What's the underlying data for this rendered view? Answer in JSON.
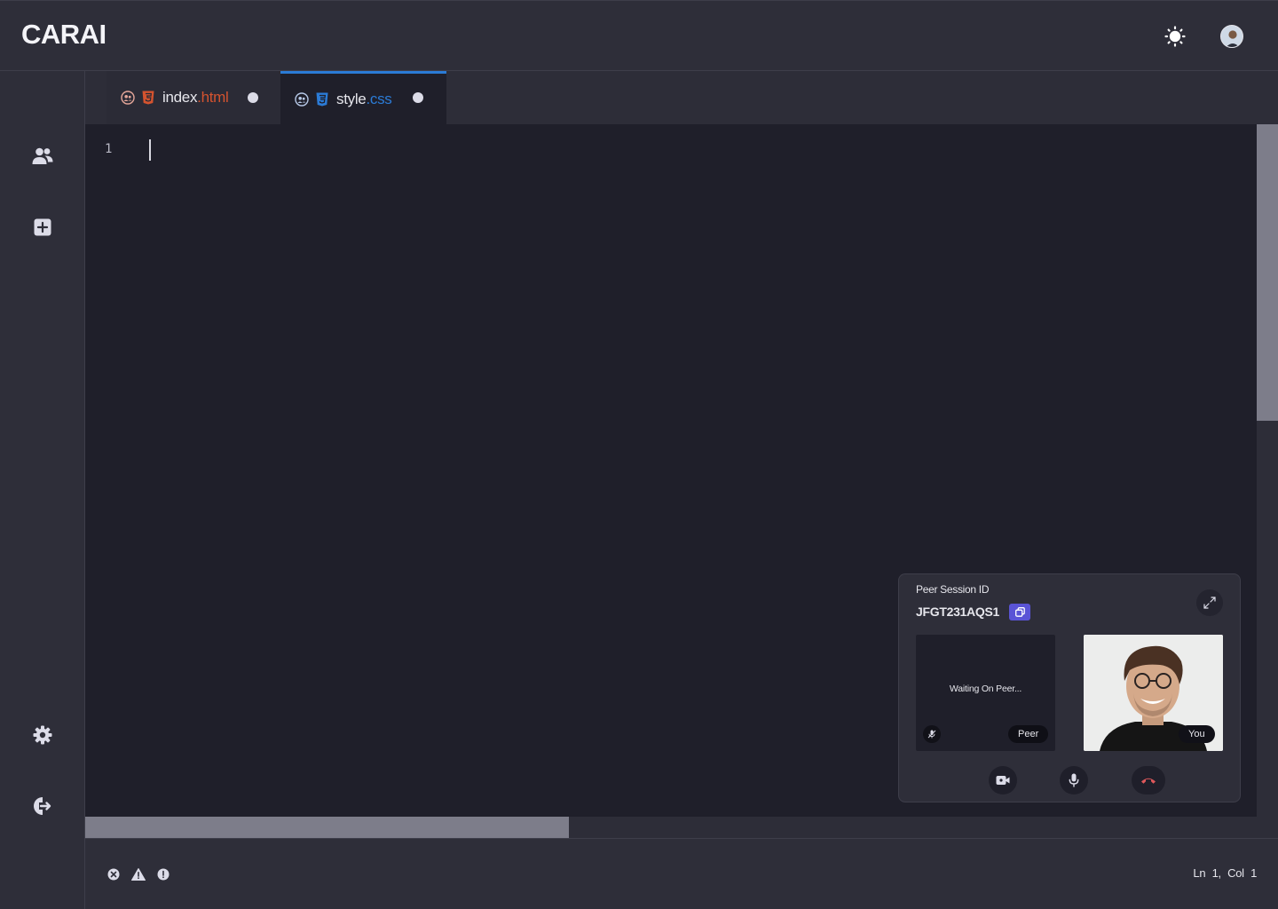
{
  "app": {
    "logo": "CARAI"
  },
  "header": {
    "theme_icon": "sun-icon",
    "avatar": "user-avatar"
  },
  "sidebar": {
    "items": [
      {
        "icon": "users-icon",
        "label": "Collaborators"
      },
      {
        "icon": "add-file-icon",
        "label": "New file"
      },
      {
        "icon": "gear-icon",
        "label": "Settings"
      },
      {
        "icon": "logout-icon",
        "label": "Logout"
      }
    ]
  },
  "tabs": [
    {
      "name": "index",
      "ext": ".html",
      "icon": "html5-icon",
      "active": false,
      "unsaved": true
    },
    {
      "name": "style",
      "ext": ".css",
      "icon": "css3-icon",
      "active": true,
      "unsaved": true
    }
  ],
  "editor": {
    "line_numbers": [
      "1"
    ]
  },
  "status": {
    "icons": [
      "error-icon",
      "warning-icon",
      "info-icon"
    ],
    "cursor_position": "Ln 1,  Col 1"
  },
  "peer_session": {
    "label": "Peer Session ID",
    "id": "JFGT231AQS1",
    "waiting_text": "Waiting On Peer...",
    "peer_tag": "Peer",
    "you_tag": "You"
  },
  "colors": {
    "accent": "#2b7bd6",
    "html": "#d4532f",
    "copy_button": "#5a54d6",
    "end_call": "#e0585b"
  }
}
